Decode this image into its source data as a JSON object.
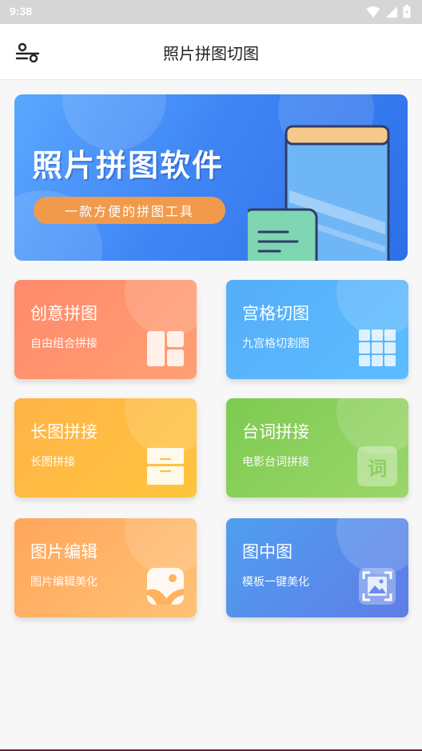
{
  "status_bar": {
    "time": "9:38"
  },
  "app_bar": {
    "title": "照片拼图切图",
    "menu_icon": "settings-sliders-icon"
  },
  "banner": {
    "headline": "照片拼图软件",
    "tagline": "一款方便的拼图工具"
  },
  "cards": [
    {
      "title": "创意拼图",
      "subtitle": "自由组合拼接",
      "icon": "collage-grid-icon"
    },
    {
      "title": "宫格切图",
      "subtitle": "九宫格切割图",
      "icon": "nine-grid-icon"
    },
    {
      "title": "长图拼接",
      "subtitle": "长图拼接",
      "icon": "drawer-stack-icon"
    },
    {
      "title": "台词拼接",
      "subtitle": "电影台词拼接",
      "icon": "subtitle-word-icon",
      "icon_text": "词"
    },
    {
      "title": "图片编辑",
      "subtitle": "图片编辑美化",
      "icon": "image-edit-icon"
    },
    {
      "title": "图中图",
      "subtitle": "模板一键美化",
      "icon": "picture-frame-icon"
    }
  ]
}
